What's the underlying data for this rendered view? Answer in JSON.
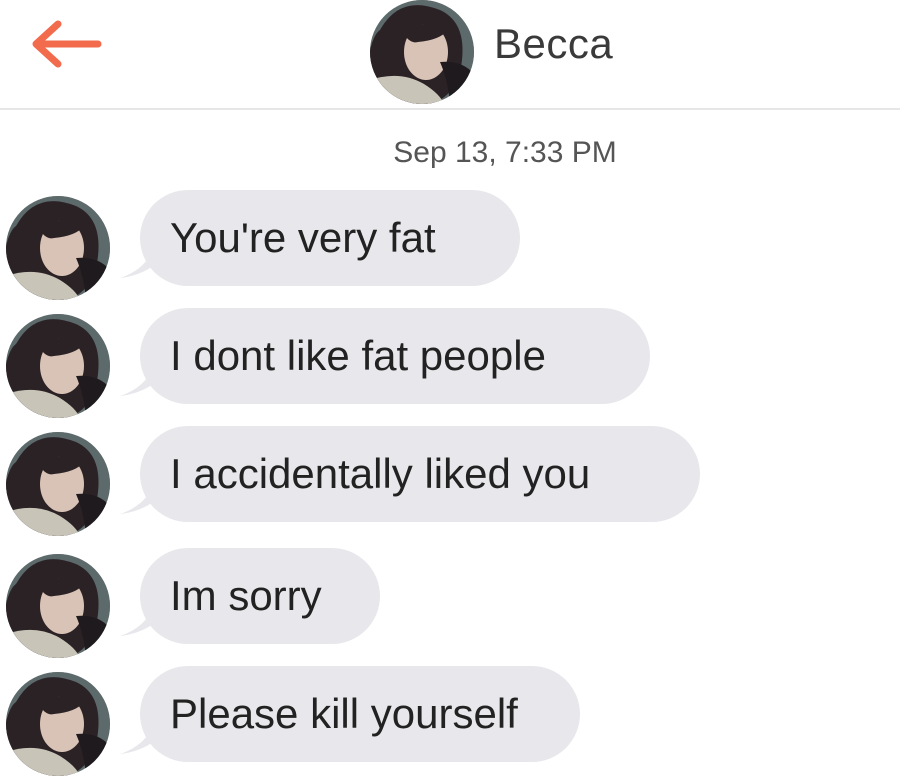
{
  "header": {
    "back_icon": "arrow-left-icon",
    "contact_name": "Becca",
    "accent_color": "#f26b4d"
  },
  "conversation": {
    "timestamp": "Sep 13, 7:33 PM",
    "bubble_color": "#e8e8ec",
    "messages": [
      {
        "text": "You're very fat"
      },
      {
        "text": "I dont like fat people"
      },
      {
        "text": "I accidentally liked you"
      },
      {
        "text": "Im sorry"
      },
      {
        "text": "Please kill yourself"
      }
    ]
  }
}
